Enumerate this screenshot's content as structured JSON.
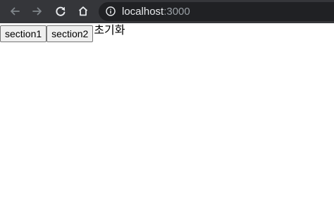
{
  "browser": {
    "nav_icons": [
      "back-arrow-icon",
      "forward-arrow-icon",
      "reload-icon",
      "home-icon"
    ],
    "address_bar": {
      "host": "localhost",
      "port": ":3000",
      "icon": "info-icon"
    },
    "colors": {
      "toolbar": "#35363a",
      "omnibox": "#202124",
      "icon_enabled": "#e8eaed",
      "icon_disabled": "#80868b"
    }
  },
  "page": {
    "buttons": [
      {
        "label": "section1"
      },
      {
        "label": "section2"
      }
    ],
    "reset_text": "초기화"
  }
}
